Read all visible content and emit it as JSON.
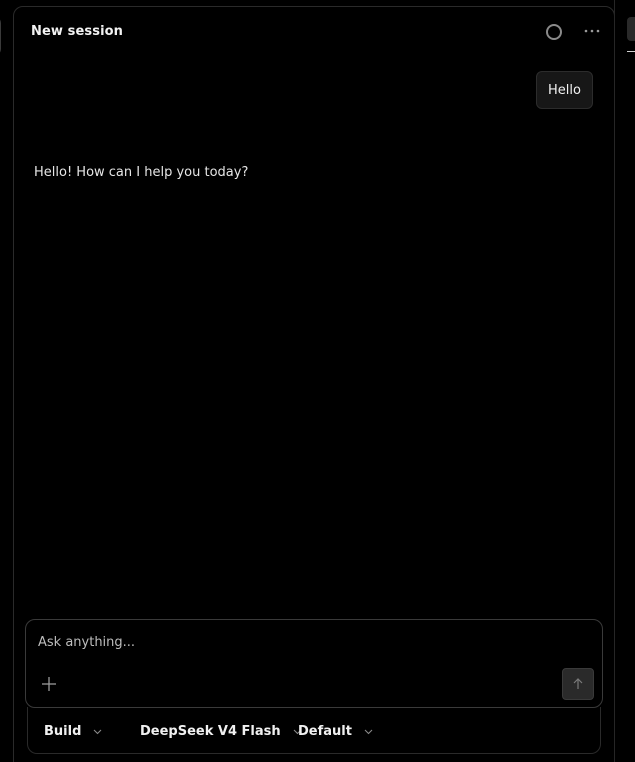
{
  "session": {
    "title": "New session"
  },
  "icons": {
    "status": "circle-status-icon",
    "more": "more-horizontal-icon",
    "add": "plus-icon",
    "send": "arrow-up-icon",
    "chevron": "chevron-down-icon"
  },
  "messages": {
    "user": "Hello",
    "assistant": "Hello! How can I help you today?"
  },
  "composer": {
    "placeholder": "Ask anything..."
  },
  "toolbar": {
    "mode": "Build",
    "model": "DeepSeek V4 Flash",
    "variant": "Default"
  },
  "colors": {
    "background": "#000000",
    "bubble": "#171717",
    "border": "#2a2a2a",
    "text": "#ededed"
  }
}
